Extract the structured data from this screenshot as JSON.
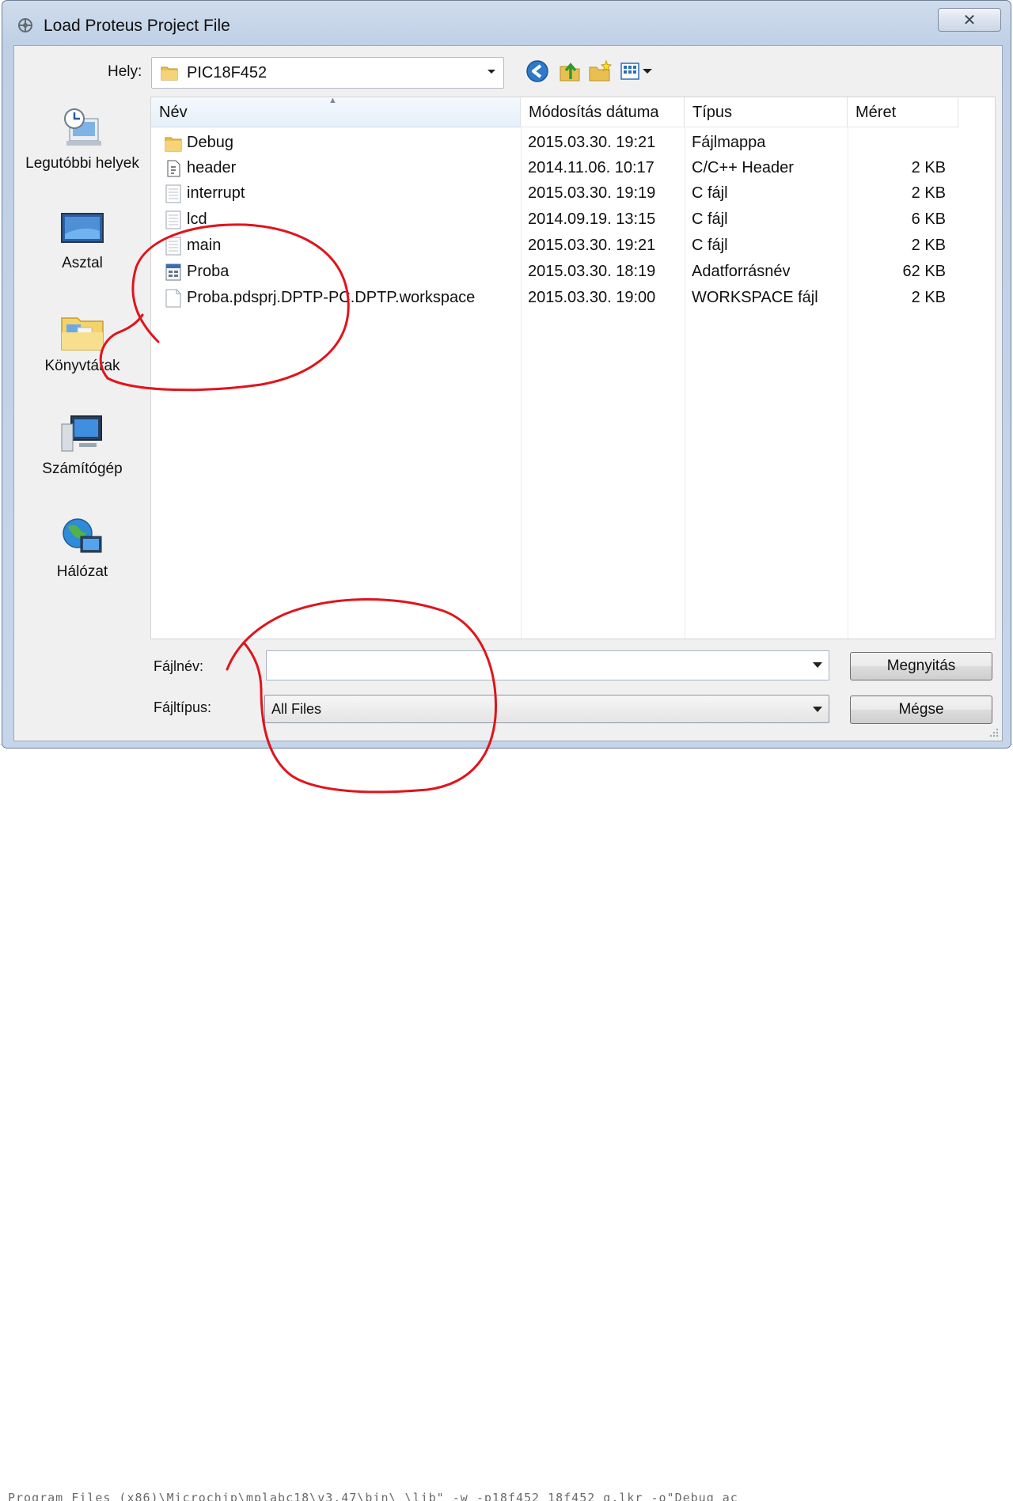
{
  "background": {
    "code_line": "Program Files (x86)\\Microchip\\mplabc18\\v3.47\\bin\\ \\lib\" -w -p18f452 18f452_g.lkr -o\"Debug ac"
  },
  "dialog": {
    "title": "Load Proteus Project File",
    "close_symbol": "✕"
  },
  "location": {
    "label": "Hely:",
    "value": "PIC18F452"
  },
  "toolbar": {
    "back_icon": "back-arrow-icon",
    "up_icon": "up-folder-icon",
    "new_folder_icon": "new-folder-icon",
    "view_icon": "view-menu-icon"
  },
  "places": [
    {
      "label": "Legutóbbi helyek",
      "icon": "recent-places-icon"
    },
    {
      "label": "Asztal",
      "icon": "desktop-icon"
    },
    {
      "label": "Könyvtárak",
      "icon": "libraries-icon"
    },
    {
      "label": "Számítógép",
      "icon": "computer-icon"
    },
    {
      "label": "Hálózat",
      "icon": "network-icon"
    }
  ],
  "columns": {
    "name": "Név",
    "date": "Módosítás dátuma",
    "type": "Típus",
    "size": "Méret"
  },
  "files": [
    {
      "name": "Debug",
      "date": "2015.03.30. 19:21",
      "type": "Fájlmappa",
      "size": "",
      "icon": "folder-icon"
    },
    {
      "name": "header",
      "date": "2014.11.06. 10:17",
      "type": "C/C++ Header",
      "size": "2 KB",
      "icon": "header-file-icon"
    },
    {
      "name": "interrupt",
      "date": "2015.03.30. 19:19",
      "type": "C fájl",
      "size": "2 KB",
      "icon": "text-file-icon"
    },
    {
      "name": "lcd",
      "date": "2014.09.19. 13:15",
      "type": "C fájl",
      "size": "6 KB",
      "icon": "text-file-icon"
    },
    {
      "name": "main",
      "date": "2015.03.30. 19:21",
      "type": "C fájl",
      "size": "2 KB",
      "icon": "text-file-icon"
    },
    {
      "name": "Proba",
      "date": "2015.03.30. 18:19",
      "type": "Adatforrásnév",
      "size": "62 KB",
      "icon": "data-source-icon"
    },
    {
      "name": "Proba.pdsprj.DPTP-PC.DPTP.workspace",
      "date": "2015.03.30. 19:00",
      "type": "WORKSPACE fájl",
      "size": "2 KB",
      "icon": "blank-file-icon"
    }
  ],
  "filename": {
    "label": "Fájlnév:",
    "value": ""
  },
  "filetype": {
    "label": "Fájltípus:",
    "value": "All Files"
  },
  "buttons": {
    "open": "Megnyitás",
    "cancel": "Mégse"
  },
  "colors": {
    "annotation": "#e0141c",
    "folder": "#e8c052"
  }
}
